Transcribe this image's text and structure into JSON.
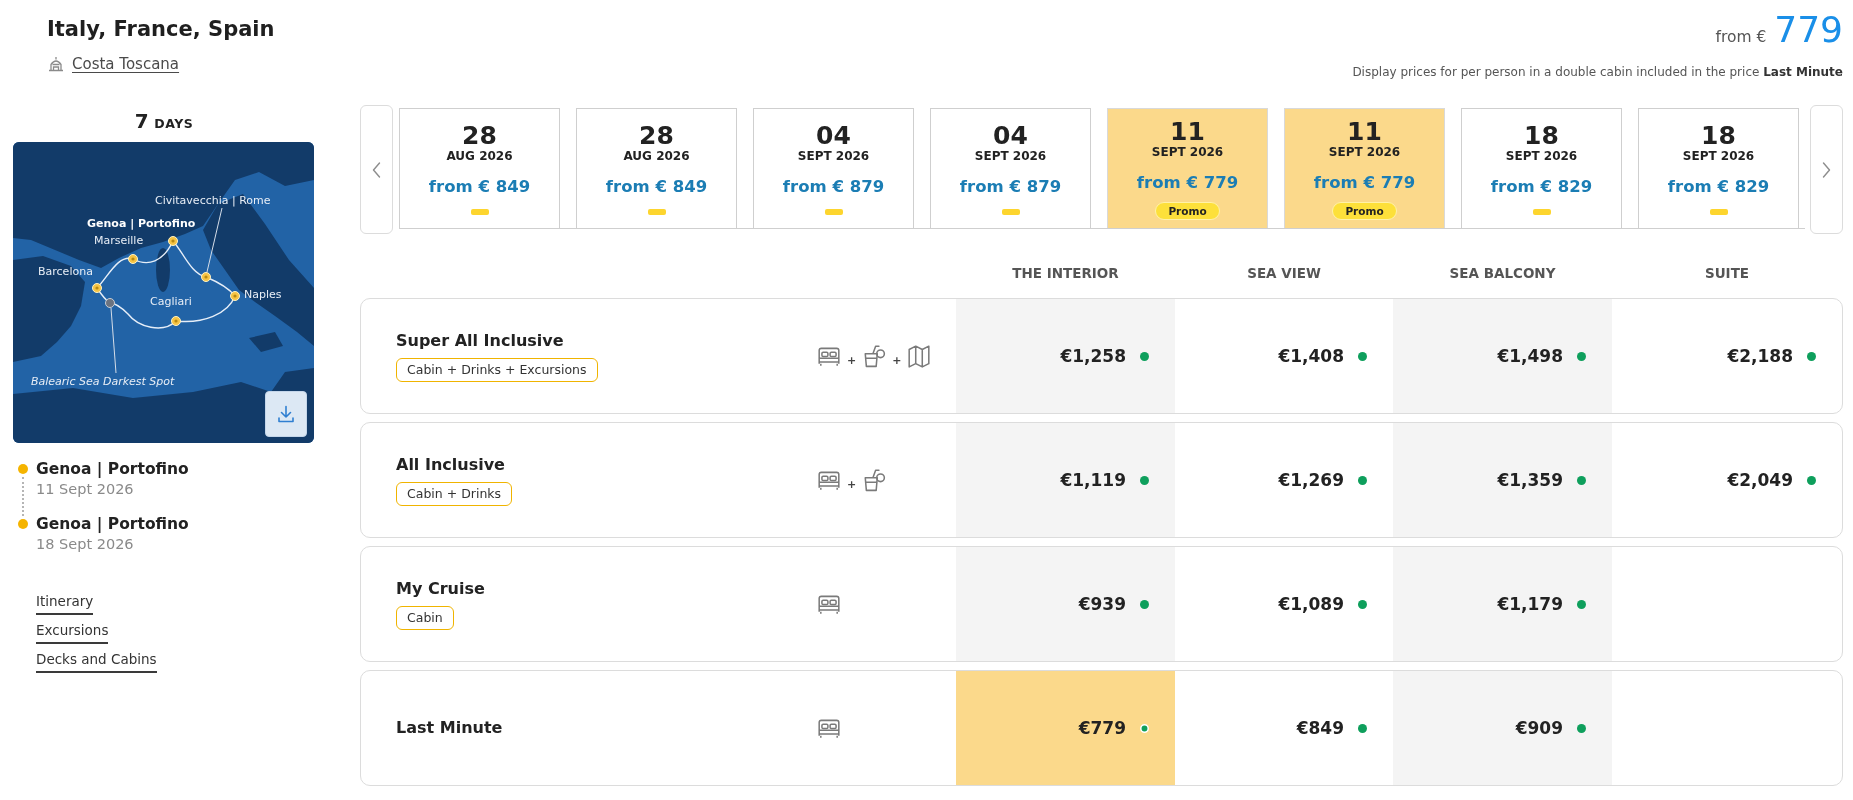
{
  "header": {
    "title": "Italy, France, Spain",
    "ship": "Costa Toscana"
  },
  "duration": {
    "number": "7",
    "unit": "DAYS"
  },
  "map": {
    "places": [
      {
        "name": "Civitavecchia | Rome",
        "kind": "port"
      },
      {
        "name": "Genoa | Portofino",
        "kind": "homeport"
      },
      {
        "name": "Marseille",
        "kind": "port"
      },
      {
        "name": "Barcelona",
        "kind": "port"
      },
      {
        "name": "Naples",
        "kind": "port"
      },
      {
        "name": "Cagliari",
        "kind": "port"
      },
      {
        "name": "Balearic Sea Darkest Spot",
        "kind": "spot"
      }
    ]
  },
  "itinerary": [
    {
      "port": "Genoa | Portofino",
      "date": "11 Sept 2026"
    },
    {
      "port": "Genoa | Portofino",
      "date": "18 Sept 2026"
    }
  ],
  "links": [
    "Itinerary",
    "Excursions",
    "Decks and Cabins"
  ],
  "price_summary": {
    "prefix": "from €",
    "amount": "779",
    "note": "Display prices for per person in a double cabin included in the price **Last Minute**"
  },
  "dates": [
    {
      "day": "28",
      "month": "AUG 2026",
      "price": "from € 849",
      "selected": false
    },
    {
      "day": "28",
      "month": "AUG 2026",
      "price": "from € 849",
      "selected": false
    },
    {
      "day": "04",
      "month": "SEPT 2026",
      "price": "from € 879",
      "selected": false
    },
    {
      "day": "04",
      "month": "SEPT 2026",
      "price": "from € 879",
      "selected": false
    },
    {
      "day": "11",
      "month": "SEPT 2026",
      "price": "from € 779",
      "selected": true,
      "badge": "Promo"
    },
    {
      "day": "11",
      "month": "SEPT 2026",
      "price": "from € 779",
      "selected": true,
      "badge": "Promo"
    },
    {
      "day": "18",
      "month": "SEPT 2026",
      "price": "from € 829",
      "selected": false
    },
    {
      "day": "18",
      "month": "SEPT 2026",
      "price": "from € 829",
      "selected": false
    }
  ],
  "table": {
    "columns": [
      "THE INTERIOR",
      "SEA VIEW",
      "SEA BALCONY",
      "SUITE"
    ],
    "rows": [
      {
        "name": "Super All Inclusive",
        "badge": "Cabin + Drinks + Excursions",
        "inclusions": [
          {
            "kind": "cabin"
          },
          {
            "kind": "drinks",
            "joiner": "+"
          },
          {
            "kind": "excursions",
            "joiner": "+"
          }
        ],
        "prices": [
          {
            "amount": "€1,258",
            "available": true,
            "selected": false
          },
          {
            "amount": "€1,408",
            "available": true,
            "selected": false
          },
          {
            "amount": "€1,498",
            "available": true,
            "selected": false
          },
          {
            "amount": "€2,188",
            "available": true,
            "selected": false
          }
        ]
      },
      {
        "name": "All Inclusive",
        "badge": "Cabin + Drinks",
        "inclusions": [
          {
            "kind": "cabin"
          },
          {
            "kind": "drinks",
            "joiner": "+"
          }
        ],
        "prices": [
          {
            "amount": "€1,119",
            "available": true,
            "selected": false
          },
          {
            "amount": "€1,269",
            "available": true,
            "selected": false
          },
          {
            "amount": "€1,359",
            "available": true,
            "selected": false
          },
          {
            "amount": "€2,049",
            "available": true,
            "selected": false
          }
        ]
      },
      {
        "name": "My Cruise",
        "badge": "Cabin",
        "inclusions": [
          {
            "kind": "cabin"
          }
        ],
        "prices": [
          {
            "amount": "€939",
            "available": true,
            "selected": false
          },
          {
            "amount": "€1,089",
            "available": true,
            "selected": false
          },
          {
            "amount": "€1,179",
            "available": true,
            "selected": false
          }
        ]
      },
      {
        "name": "Last Minute",
        "inclusions": [
          {
            "kind": "cabin"
          }
        ],
        "prices": [
          {
            "amount": "€779",
            "available": true,
            "selected": true
          },
          {
            "amount": "€849",
            "available": true,
            "selected": false
          },
          {
            "amount": "€909",
            "available": true,
            "selected": false
          }
        ]
      }
    ]
  }
}
